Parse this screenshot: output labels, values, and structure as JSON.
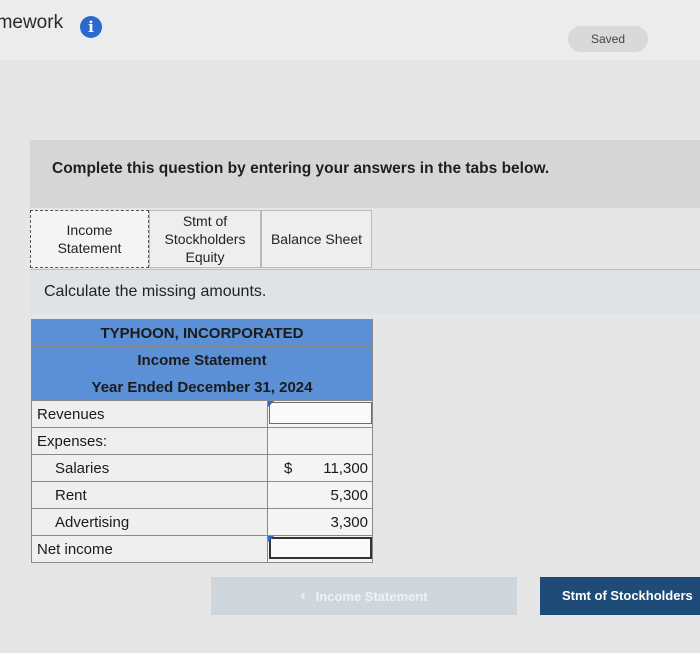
{
  "header": {
    "title": "omework",
    "info_icon": "i",
    "saved_label": "Saved"
  },
  "instruction": "Complete this question by entering your answers in the tabs below.",
  "tabs": [
    {
      "label": "Income\nStatement",
      "active": true
    },
    {
      "label": "Stmt of\nStockholders\nEquity",
      "active": false
    },
    {
      "label": "Balance Sheet",
      "active": false
    }
  ],
  "prompt": "Calculate the missing amounts.",
  "statement": {
    "company": "TYPHOON, INCORPORATED",
    "name": "Income Statement",
    "period": "Year Ended December 31, 2024",
    "rows": {
      "revenues": {
        "label": "Revenues",
        "value": ""
      },
      "expenses": {
        "label": "Expenses:"
      },
      "salaries": {
        "label": "Salaries",
        "currency": "$",
        "value": "11,300"
      },
      "rent": {
        "label": "Rent",
        "value": "5,300"
      },
      "advertising": {
        "label": "Advertising",
        "value": "3,300"
      },
      "net_income": {
        "label": "Net income",
        "value": ""
      }
    }
  },
  "nav": {
    "prev_label": "Income Statement",
    "prev_icon": "chevron-left",
    "next_label": "Stmt of Stockholders"
  }
}
